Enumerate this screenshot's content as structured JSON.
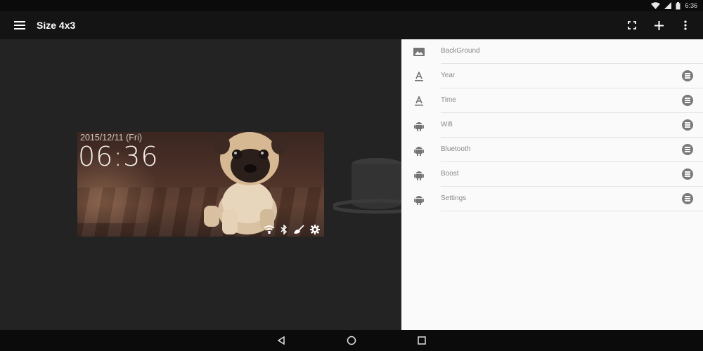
{
  "status_bar": {
    "time": "6:36"
  },
  "app_bar": {
    "title": "Size 4x3",
    "menu_icon": "hamburger-menu-icon",
    "actions": [
      "fullscreen-icon",
      "add-icon",
      "more-vert-icon"
    ]
  },
  "widget": {
    "date": "2015/12/11 (Fri)",
    "time": "06:36",
    "icons": [
      "wifi-icon",
      "bluetooth-icon",
      "boost-broom-icon",
      "settings-gear-icon"
    ]
  },
  "panel": {
    "items": [
      {
        "label": "BackGround",
        "icon": "image-icon"
      },
      {
        "label": "Year",
        "icon": "text-format-icon"
      },
      {
        "label": "Time",
        "icon": "text-format-icon"
      },
      {
        "label": "Wifi",
        "icon": "android-icon"
      },
      {
        "label": "Bluetooth",
        "icon": "android-icon"
      },
      {
        "label": "Boost",
        "icon": "android-icon"
      },
      {
        "label": "Settings",
        "icon": "android-icon"
      }
    ]
  },
  "colors": {
    "panel_bg": "#fafafa",
    "preview_bg": "#232323",
    "appbar_bg": "#141414",
    "remove_icon": "#7a7a7a"
  }
}
